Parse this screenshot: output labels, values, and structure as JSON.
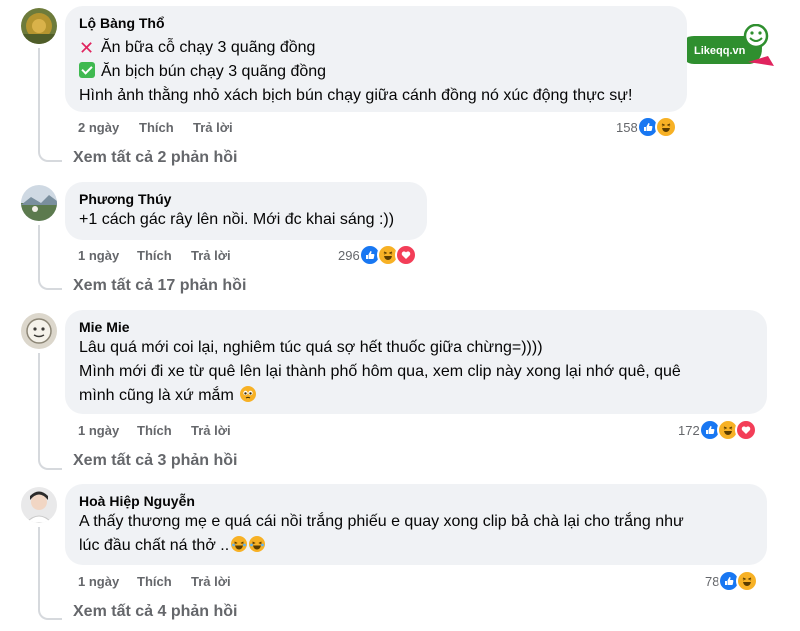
{
  "watermark": {
    "brand_text": "Likeqq.vn"
  },
  "comments": [
    {
      "author": "Lộ Bàng Thổ",
      "lines": [
        "Ăn bữa cỗ chạy 3 quãng đồng",
        "Ăn bịch bún chạy 3 quãng đồng",
        "Hình ảnh thằng nhỏ xách bịch bún chạy giữa cánh đồng nó xúc động thực sự!"
      ],
      "time": "2 ngày",
      "like_label": "Thích",
      "reply_label": "Trả lời",
      "reaction_count": "158",
      "reactions": [
        "like-icon",
        "haha-icon"
      ],
      "view_replies": "Xem tất cả 2 phản hồi"
    },
    {
      "author": "Phương Thúy",
      "lines": [
        "+1 cách gác rây lên nồi. Mới đc khai sáng :))"
      ],
      "time": "1 ngày",
      "like_label": "Thích",
      "reply_label": "Trả lời",
      "reaction_count": "296",
      "reactions": [
        "like-icon",
        "haha-icon",
        "love-icon"
      ],
      "view_replies": "Xem tất cả 17 phản hồi"
    },
    {
      "author": "Mie Mie",
      "lines": [
        "Lâu quá mới coi lại, nghiêm túc quá sợ hết thuốc giữa chừng=))))",
        "Mình mới đi xe từ quê lên lại thành phố hôm qua, xem clip này xong lại nhớ quê, quê",
        "mình cũng là xứ mắm"
      ],
      "time": "1 ngày",
      "like_label": "Thích",
      "reply_label": "Trả lời",
      "reaction_count": "172",
      "reactions": [
        "like-icon",
        "haha-icon",
        "love-icon"
      ],
      "view_replies": "Xem tất cả 3 phản hồi"
    },
    {
      "author": "Hoà Hiệp Nguyễn",
      "lines": [
        "A thấy thương mẹ e quá cái nồi trắng phiếu e quay xong clip bả chà lại cho trắng như",
        "lúc đầu chất ná thở .."
      ],
      "time": "1 ngày",
      "like_label": "Thích",
      "reply_label": "Trả lời",
      "reaction_count": "78",
      "reactions": [
        "like-icon",
        "haha-icon"
      ],
      "view_replies": "Xem tất cả 4 phản hồi"
    }
  ]
}
